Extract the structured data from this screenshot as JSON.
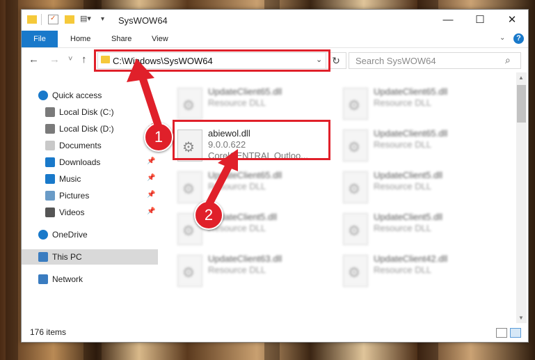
{
  "window": {
    "title": "SysWOW64",
    "controls": {
      "minimize": "—",
      "maximize": "☐",
      "close": "✕"
    }
  },
  "ribbon": {
    "file_tab": "File",
    "tabs": [
      "Home",
      "Share",
      "View"
    ],
    "help": "?"
  },
  "navigation": {
    "back": "←",
    "forward": "→",
    "recent": "˅",
    "up": "↑",
    "address": "C:\\Windows\\SysWOW64",
    "refresh": "↻",
    "search_placeholder": "Search SysWOW64"
  },
  "sidebar": {
    "items": [
      {
        "label": "Quick access",
        "icon": "star-icon",
        "pinned": false
      },
      {
        "label": "Local Disk (C:)",
        "icon": "drive-icon",
        "pinned": false
      },
      {
        "label": "Local Disk (D:)",
        "icon": "drive-icon",
        "pinned": true
      },
      {
        "label": "Documents",
        "icon": "documents-icon",
        "pinned": true
      },
      {
        "label": "Downloads",
        "icon": "downloads-icon",
        "pinned": true
      },
      {
        "label": "Music",
        "icon": "music-icon",
        "pinned": true
      },
      {
        "label": "Pictures",
        "icon": "pictures-icon",
        "pinned": true
      },
      {
        "label": "Videos",
        "icon": "videos-icon",
        "pinned": true
      },
      {
        "label": "OneDrive",
        "icon": "cloud-icon",
        "pinned": false
      },
      {
        "label": "This PC",
        "icon": "computer-icon",
        "pinned": false,
        "selected": true
      },
      {
        "label": "Network",
        "icon": "network-icon",
        "pinned": false
      }
    ]
  },
  "files": [
    {
      "name": "UpdateClient65.dll",
      "line2": "Resource DLL",
      "line3": "",
      "blurred": true
    },
    {
      "name": "UpdateClient65.dll",
      "line2": "Resource DLL",
      "line3": "",
      "blurred": true
    },
    {
      "name": "abiewol.dll",
      "line2": "9.0.0.622",
      "line3": "CorelCENTRAL Outloo...",
      "blurred": false
    },
    {
      "name": "UpdateClient65.dll",
      "line2": "Resource DLL",
      "line3": "",
      "blurred": true
    },
    {
      "name": "UpdateClient65.dll",
      "line2": "Resource DLL",
      "line3": "",
      "blurred": true
    },
    {
      "name": "UpdateClient5.dll",
      "line2": "Resource DLL",
      "line3": "",
      "blurred": true
    },
    {
      "name": "UpdateClient5.dll",
      "line2": "Resource DLL",
      "line3": "",
      "blurred": true
    },
    {
      "name": "UpdateClient5.dll",
      "line2": "Resource DLL",
      "line3": "",
      "blurred": true
    },
    {
      "name": "UpdateClient63.dll",
      "line2": "Resource DLL",
      "line3": "",
      "blurred": true
    },
    {
      "name": "UpdateClient42.dll",
      "line2": "Resource DLL",
      "line3": "",
      "blurred": true
    }
  ],
  "status": {
    "item_count": "176 items"
  },
  "annotations": {
    "step1": "1",
    "step2": "2",
    "highlight_color": "#e0202a"
  },
  "colors": {
    "accent": "#1979ca",
    "selection": "#d9d9d9"
  }
}
